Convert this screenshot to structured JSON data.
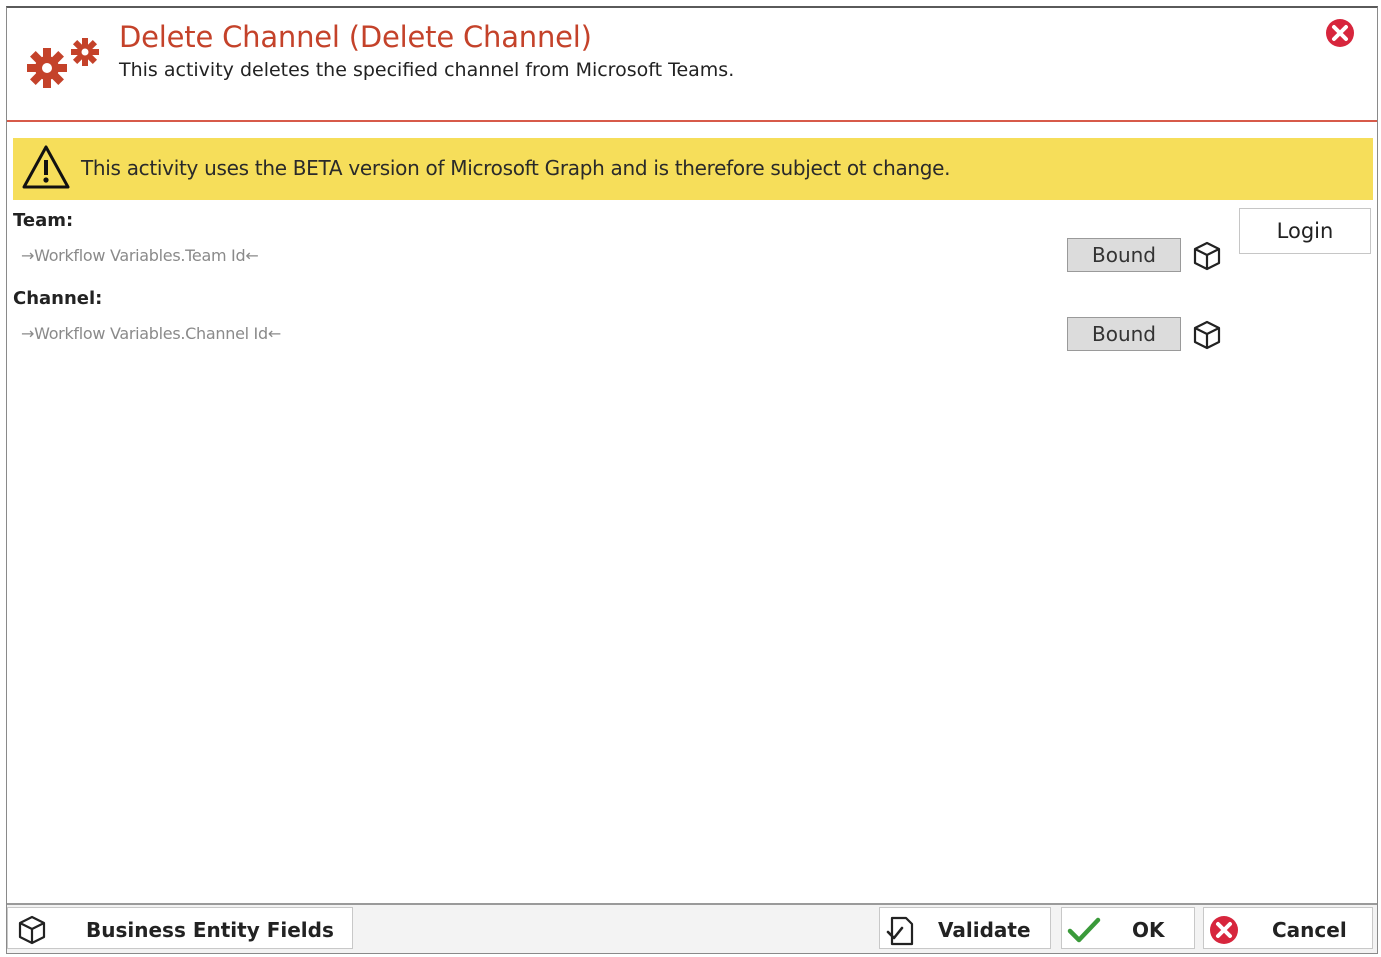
{
  "header": {
    "title": "Delete Channel (Delete Channel)",
    "subtitle": "This activity deletes the specified channel from Microsoft Teams."
  },
  "warning": {
    "text": "This activity uses the BETA version of Microsoft Graph and is therefore subject ot change."
  },
  "fields": [
    {
      "label": "Team:",
      "value": "→Workflow Variables.Team Id←",
      "bound_label": "Bound"
    },
    {
      "label": "Channel:",
      "value": "→Workflow Variables.Channel Id←",
      "bound_label": "Bound"
    }
  ],
  "login_label": "Login",
  "footer": {
    "business_fields_label": "Business Entity Fields",
    "validate_label": "Validate",
    "ok_label": "OK",
    "cancel_label": "Cancel"
  },
  "colors": {
    "title_red": "#c4422a",
    "warning_yellow": "#f6de5a",
    "ok_green": "#3a9a3a",
    "close_red": "#d7263d"
  },
  "icons": [
    "gear-icon",
    "close-icon",
    "warning-icon",
    "cube-icon",
    "validate-icon",
    "check-icon",
    "cancel-icon"
  ]
}
